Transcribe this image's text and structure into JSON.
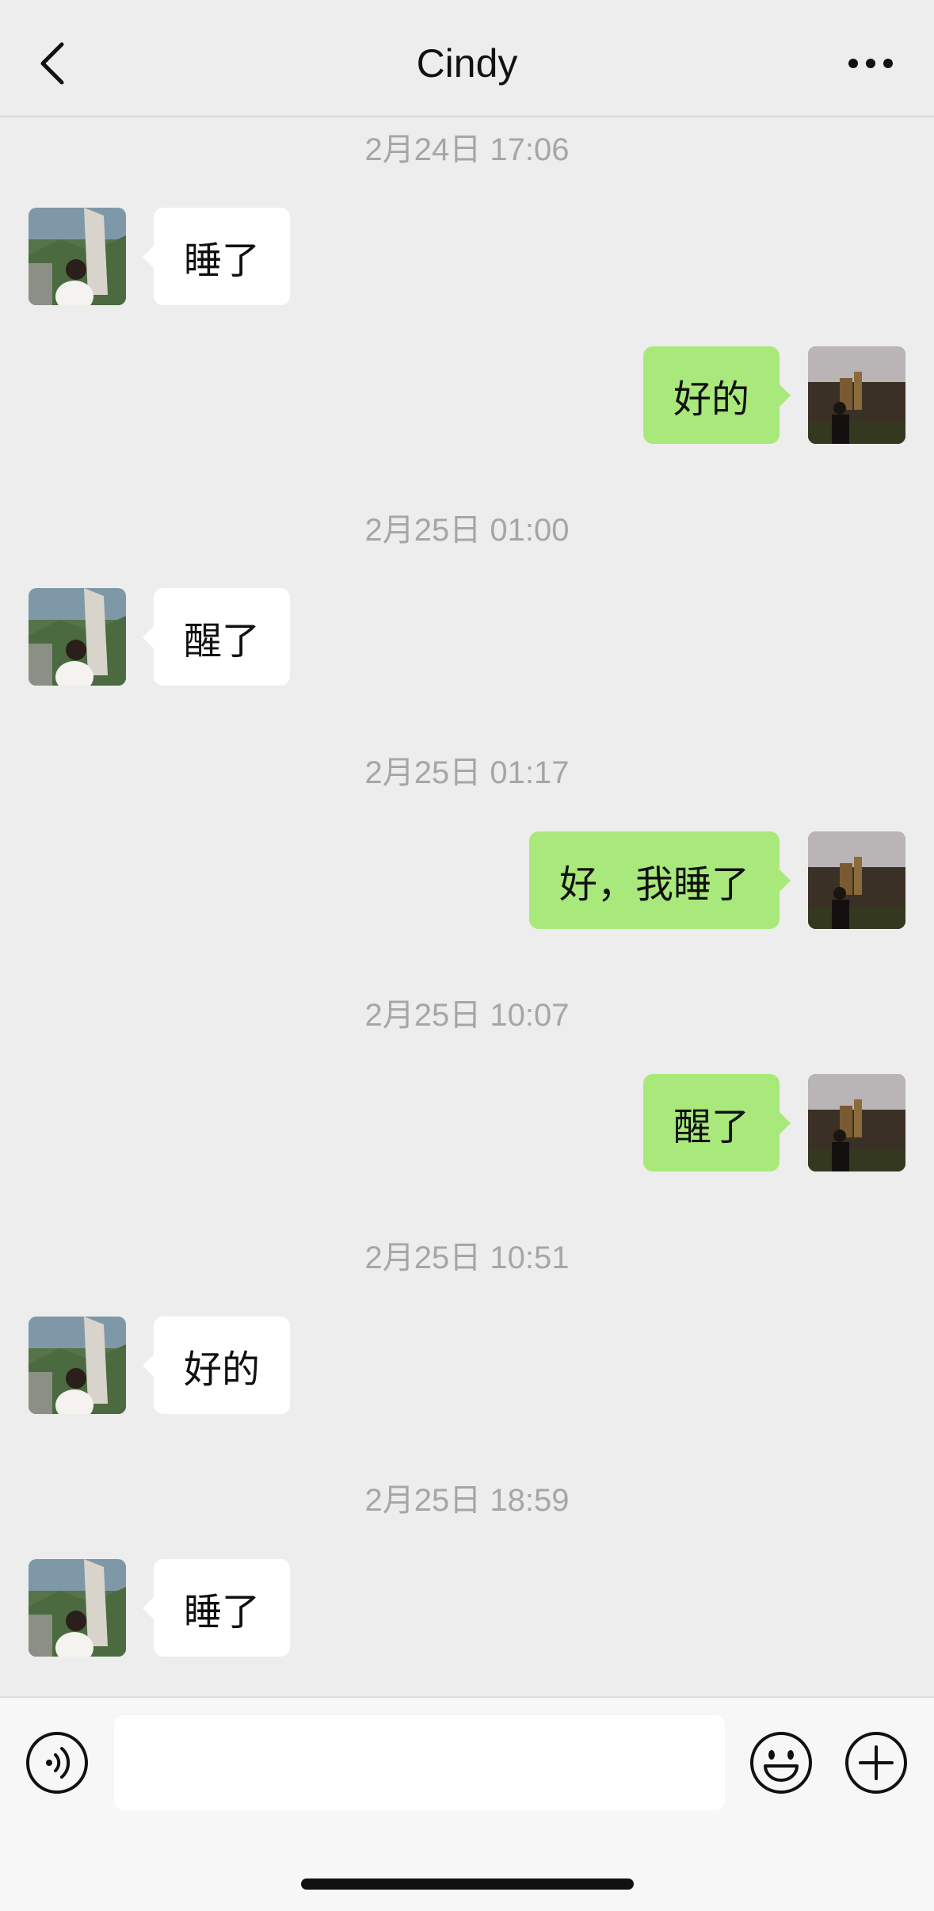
{
  "header": {
    "title": "Cindy",
    "back_icon": "chevron-left-icon",
    "more_icon": "ellipsis-icon"
  },
  "messages": [
    {
      "type": "time",
      "text": "2月24日 17:06"
    },
    {
      "type": "msg",
      "from": "contact",
      "text": "睡了"
    },
    {
      "type": "msg",
      "from": "me",
      "text": "好的"
    },
    {
      "type": "time",
      "text": "2月25日 01:00"
    },
    {
      "type": "msg",
      "from": "contact",
      "text": "醒了"
    },
    {
      "type": "time",
      "text": "2月25日 01:17"
    },
    {
      "type": "msg",
      "from": "me",
      "text": "好，我睡了"
    },
    {
      "type": "time",
      "text": "2月25日 10:07"
    },
    {
      "type": "msg",
      "from": "me",
      "text": "醒了"
    },
    {
      "type": "time",
      "text": "2月25日 10:51"
    },
    {
      "type": "msg",
      "from": "contact",
      "text": "好的"
    },
    {
      "type": "time",
      "text": "2月25日 18:59"
    },
    {
      "type": "msg",
      "from": "contact",
      "text": "睡了"
    }
  ],
  "input_bar": {
    "voice_icon": "voice-icon",
    "emoji_icon": "emoji-icon",
    "plus_icon": "plus-icon",
    "input_value": ""
  },
  "colors": {
    "background": "#ededed",
    "incoming_bubble": "#ffffff",
    "outgoing_bubble": "#a9e97b",
    "timestamp": "#a6a6a6"
  }
}
